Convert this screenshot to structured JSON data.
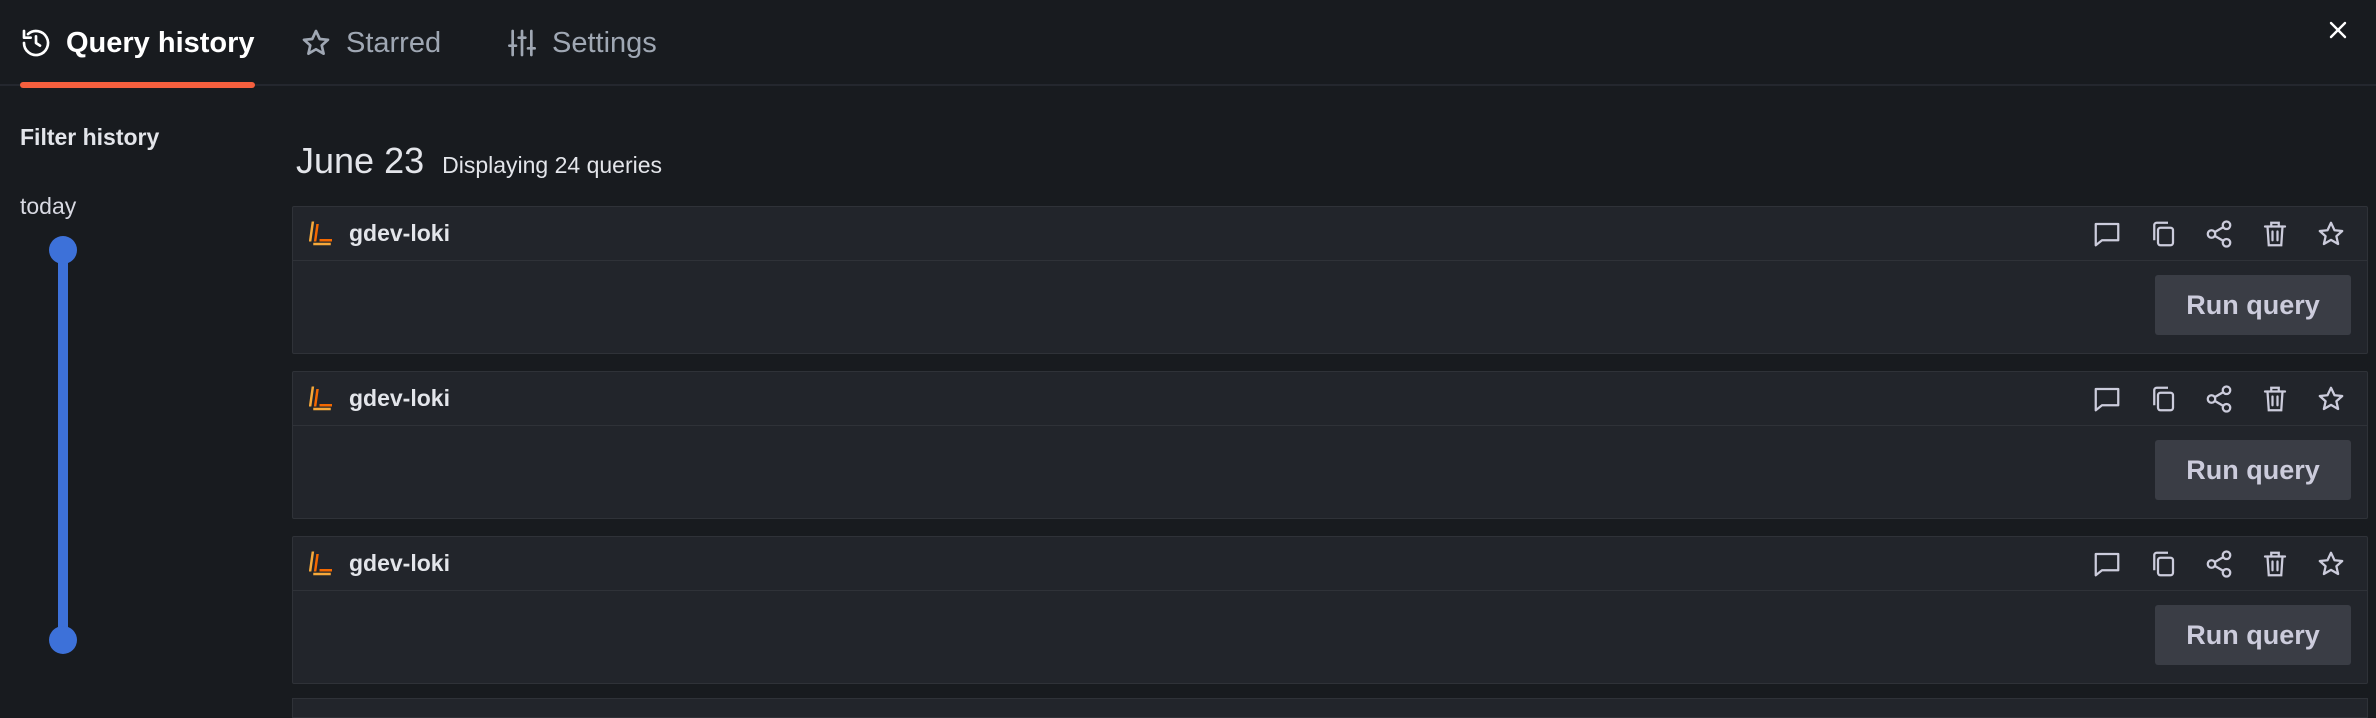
{
  "tabs": [
    {
      "label": "Query history",
      "icon": "history-icon",
      "active": true
    },
    {
      "label": "Starred",
      "icon": "star-icon",
      "active": false
    },
    {
      "label": "Settings",
      "icon": "sliders-icon",
      "active": false
    }
  ],
  "colors": {
    "accent": "#f55f3e",
    "slider": "#3d71d9",
    "background": "#181b1f",
    "card": "#22252b"
  },
  "sidebar": {
    "title": "Filter history",
    "range_label": "today"
  },
  "main": {
    "date": "June 23",
    "count_text": "Displaying 24 queries",
    "cards": [
      {
        "datasource": "gdev-loki",
        "run_label": "Run query"
      },
      {
        "datasource": "gdev-loki",
        "run_label": "Run query"
      },
      {
        "datasource": "gdev-loki",
        "run_label": "Run query"
      }
    ],
    "card_actions": [
      "comment-icon",
      "copy-icon",
      "share-icon",
      "delete-icon",
      "star-icon"
    ]
  }
}
